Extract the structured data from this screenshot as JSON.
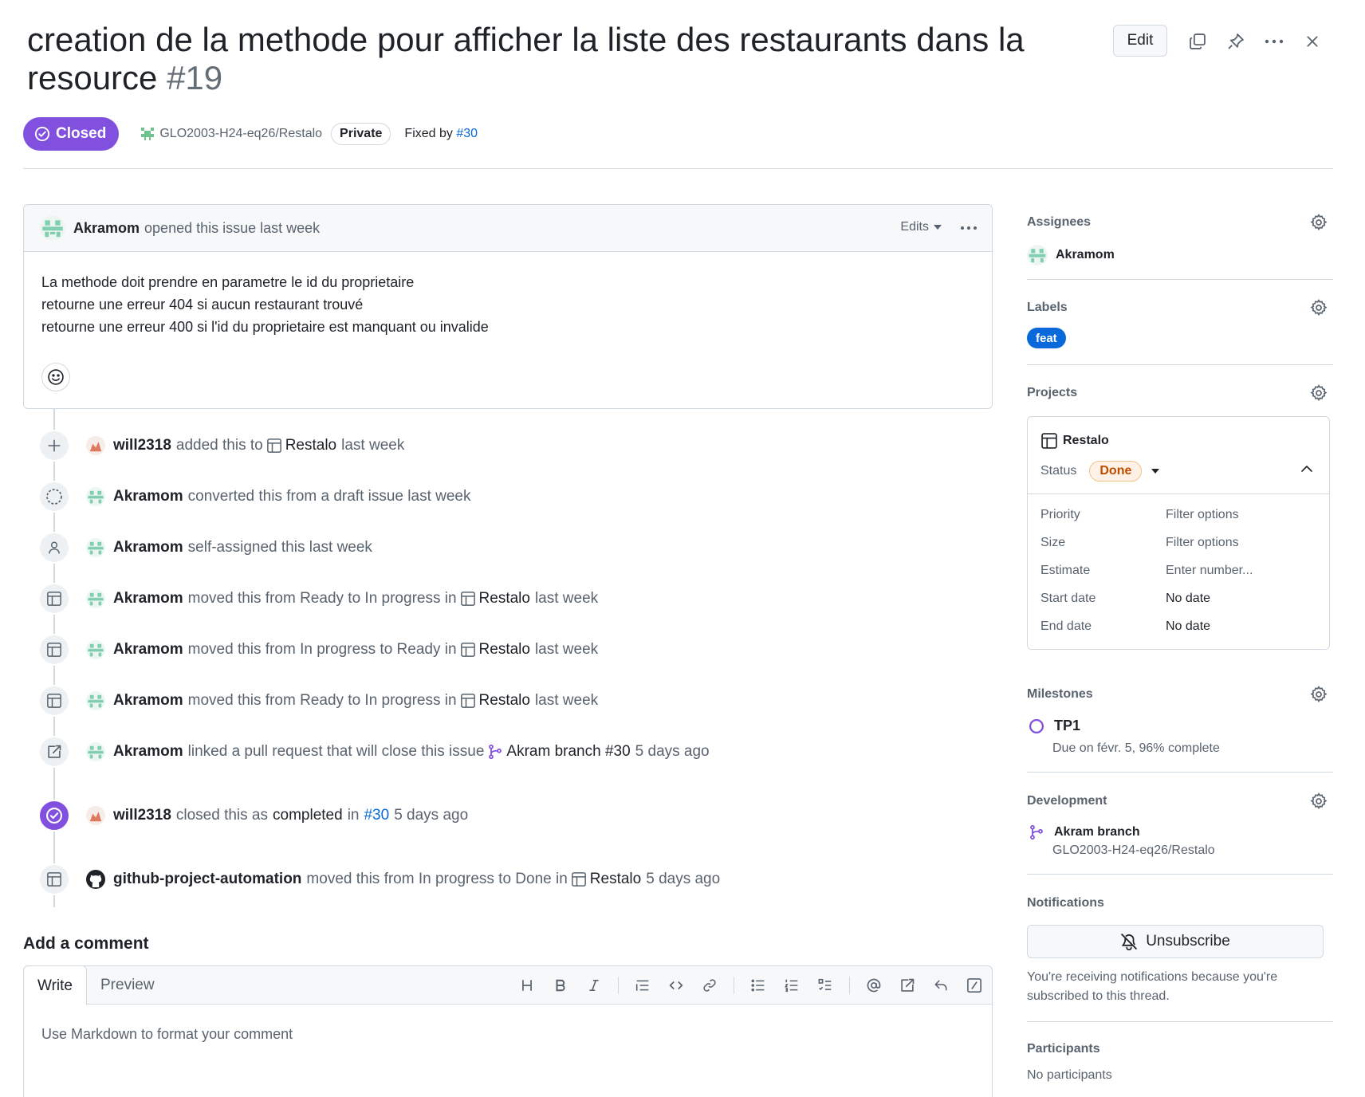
{
  "issue": {
    "title": "creation de la methode pour afficher la liste des restaurants dans la resource",
    "number": "#19",
    "edit_label": "Edit",
    "state": "Closed",
    "repo": "GLO2003-H24-eq26/Restalo",
    "visibility": "Private",
    "fixed_by_prefix": "Fixed by",
    "fixed_by_link": "#30"
  },
  "comment": {
    "author": "Akramom",
    "action": "opened this issue last week",
    "edits_label": "Edits",
    "body_lines": [
      "La methode doit prendre en parametre le id du proprietaire",
      "retourne une erreur 404 si aucun restaurant trouvé",
      "retourne une erreur 400 si l'id du proprietaire est manquant ou invalide"
    ]
  },
  "timeline": [
    {
      "icon": "plus-icon",
      "actor": "will2318",
      "before": "added this to",
      "project": "Restalo",
      "after": "last week"
    },
    {
      "icon": "draft-icon",
      "actor": "Akramom",
      "before": "converted this from a draft issue last week"
    },
    {
      "icon": "person-icon",
      "actor": "Akramom",
      "before": "self-assigned this  last week"
    },
    {
      "icon": "table-icon",
      "actor": "Akramom",
      "before": "moved this from Ready to In progress in",
      "project": "Restalo",
      "after": "last week"
    },
    {
      "icon": "table-icon",
      "actor": "Akramom",
      "before": "moved this from In progress to Ready in",
      "project": "Restalo",
      "after": "last week"
    },
    {
      "icon": "table-icon",
      "actor": "Akramom",
      "before": "moved this from Ready to In progress in",
      "project": "Restalo",
      "after": "last week"
    },
    {
      "icon": "cross-reference-icon",
      "actor": "Akramom",
      "before": "linked a pull request that will close this issue",
      "branch": "Akram branch #30",
      "after": "5 days ago"
    },
    {
      "icon": "check-circle-icon",
      "actor": "will2318",
      "before": "closed this as",
      "strong": "completed",
      "mid": "in",
      "link": "#30",
      "after": "5 days ago"
    },
    {
      "icon": "table-icon",
      "actor": "github-project-automation",
      "before": "moved this from In progress to Done in",
      "project": "Restalo",
      "after": "5 days ago"
    }
  ],
  "add_comment": {
    "title": "Add a comment",
    "tab_write": "Write",
    "tab_preview": "Preview",
    "placeholder": "Use Markdown to format your comment"
  },
  "sidebar": {
    "assignees_title": "Assignees",
    "assignee": "Akramom",
    "labels_title": "Labels",
    "label": "feat",
    "label_color": "#0969da",
    "projects_title": "Projects",
    "project": {
      "name": "Restalo",
      "status_label": "Status",
      "status_value": "Done",
      "fields": [
        {
          "key": "Priority",
          "value": "Filter options"
        },
        {
          "key": "Size",
          "value": "Filter options"
        },
        {
          "key": "Estimate",
          "value": "Enter number..."
        },
        {
          "key": "Start date",
          "value": "No date"
        },
        {
          "key": "End date",
          "value": "No date"
        }
      ]
    },
    "milestones_title": "Milestones",
    "milestone": "TP1",
    "milestone_sub": "Due on févr. 5, 96% complete",
    "development_title": "Development",
    "dev_branch": "Akram branch",
    "dev_repo": "GLO2003-H24-eq26/Restalo",
    "notifications_title": "Notifications",
    "unsubscribe": "Unsubscribe",
    "notif_text": "You're receiving notifications because you're subscribed to this thread.",
    "participants_title": "Participants",
    "participants_none": "No participants"
  },
  "colors": {
    "accent_purple": "#8250df",
    "link_blue": "#0969da",
    "done_orange": "#bc4c00"
  }
}
